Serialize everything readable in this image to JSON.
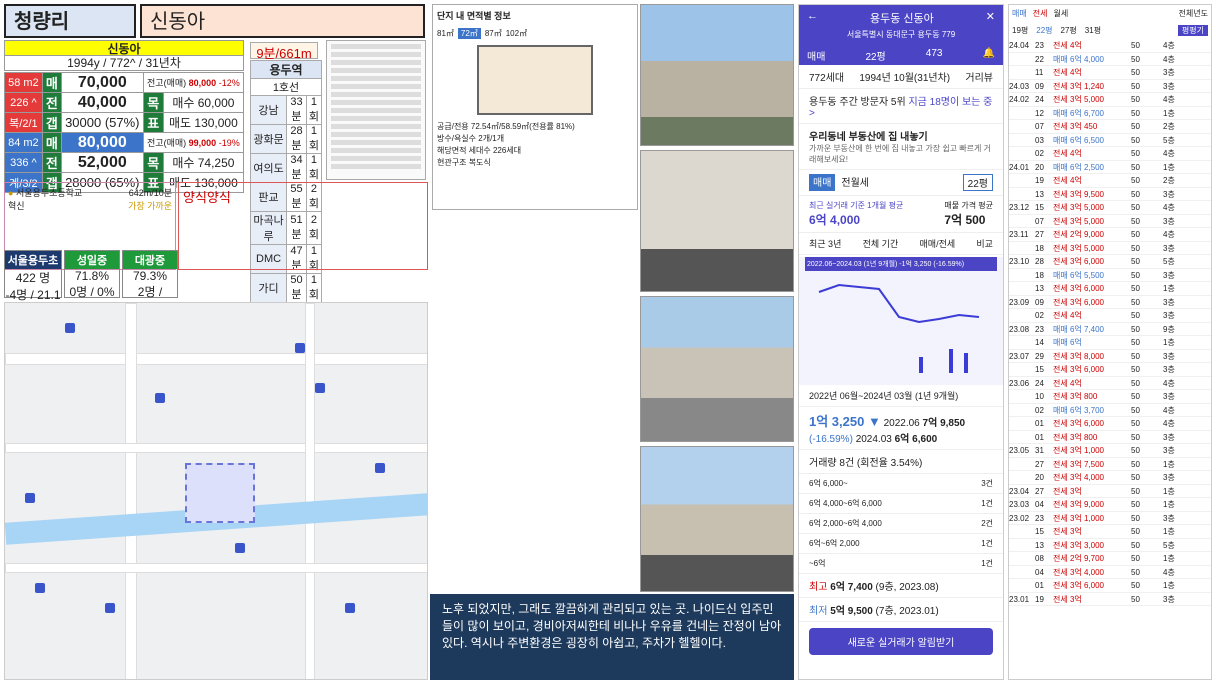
{
  "header": {
    "region": "청량리",
    "complex": "신동아"
  },
  "summary": {
    "name": "신동아",
    "sub": "1994y / 772^ / 31년차",
    "walk": "9분/661m"
  },
  "units": [
    {
      "size": "58 m2",
      "floors": "226 ^",
      "cfg": "복/2/1",
      "sale_label": "매",
      "sale": "70,000",
      "jeonse_label": "전",
      "jeonse": "40,000",
      "gap_label": "갭",
      "gap": "30000 (57%)",
      "high_label": "전고(매매)",
      "high": "80,000",
      "high_pct": "-12%",
      "mok": "목",
      "mok_label": "매수",
      "mok_val": "60,000",
      "pyo": "표",
      "pyo_label": "매도",
      "pyo_val": "130,000"
    },
    {
      "size": "84 m2",
      "floors": "336 ^",
      "cfg": "계/3/2",
      "sale_label": "매",
      "sale": "80,000",
      "jeonse_label": "전",
      "jeonse": "52,000",
      "gap_label": "갭",
      "gap": "28000 (65%)",
      "high_label": "전고(매매)",
      "high": "99,000",
      "high_pct": "-19%",
      "mok": "목",
      "mok_label": "매수",
      "mok_val": "74,250",
      "pyo": "표",
      "pyo_label": "매도",
      "pyo_val": "136,000"
    }
  ],
  "station": {
    "name": "용두역",
    "line": "1호선",
    "rows": [
      [
        "강남",
        "33분",
        "1회"
      ],
      [
        "광화문",
        "28분",
        "1회"
      ],
      [
        "여의도",
        "34분",
        "1회"
      ],
      [
        "판교",
        "55분",
        "2회"
      ],
      [
        "마곡나루",
        "51분",
        "2회"
      ],
      [
        "DMC",
        "47분",
        "1회"
      ],
      [
        "가디",
        "50분",
        "1회"
      ]
    ]
  },
  "school": {
    "name": "서울용두초등학교",
    "dist": "642m/10분",
    "type": "혁신",
    "note": "가장 가까운"
  },
  "memo": "양식양식",
  "schools": [
    {
      "name": "서울용두초",
      "v1": "422 명",
      "v2": "-4명 / 21.1"
    },
    {
      "name": "성일중",
      "v1": "71.8%",
      "v2": "0명 / 0%"
    },
    {
      "name": "대광중",
      "v1": "79.3%",
      "v2": "2명 / 1.6%"
    }
  ],
  "floorplan": {
    "title": "단지 내 면적별 정보",
    "tabs": [
      "81㎡",
      "72㎡",
      "87㎡",
      "102㎡"
    ],
    "label_area": "공급/전용",
    "area": "72.54㎡/58.59㎡(전용률 81%)",
    "label_rooms": "방수/욕실수",
    "rooms": "2개/1개",
    "label_count": "해당면적 세대수",
    "count": "226세대",
    "label_struct": "현관구조",
    "struct": "복도식"
  },
  "note": "노후 되었지만, 그래도 깔끔하게 관리되고 있는 곳. 나이드신 입주민들이 많이 보이고, 경비아저씨한테 비나나 우유를 건네는 잔정이 남아있다. 역시나 주변환경은 굉장히 아쉽고, 주차가 헬헬이다.",
  "app": {
    "title": "용두동 신동아",
    "address": "서울특별시 동대문구 용두동 779",
    "tab": "매매",
    "size": "22평",
    "comments": "473",
    "households": "772세대",
    "built": "1994년 10월(31년차)",
    "dist_btn": "거리뷰",
    "visitors": "용두동 주간 방문자 5위",
    "visitors_link": "지금 18명이 보는 중 >",
    "ad_title": "우리동네 부동산에 집 내놓기",
    "ad_body": "가까운 부동산에 한 번에 집 내놓고 가장 쉽고 빠르게 거래해보세요!",
    "tab_sale": "매매",
    "tab_jeonse": "전월세",
    "dd": "22평",
    "avg_label": "최근 실거래 기준 1개월 평균",
    "avg": "6억 4,000",
    "ask_label": "매물 가격 평균",
    "ask": "7억 500",
    "period_tabs": [
      "최근 3년",
      "전체 기간",
      "매매/전세",
      "비교"
    ],
    "chart_badge": "2022.06~2024.03 (1년 9개월)  -1억 3,250 (-16.59%)",
    "range": "2022년 06월~2024년 03월 (1년 9개월)",
    "drop": "1억 3,250 ▼",
    "drop_pct": "(-16.59%)",
    "p1_label": "2022.06",
    "p1": "7억 9,850",
    "p2_label": "2024.03",
    "p2": "6억 6,600",
    "vol": "거래량 8건 (회전율 3.54%)",
    "bins": [
      [
        "6억 6,000~",
        "3건"
      ],
      [
        "6억 4,000~6억 6,000",
        "1건"
      ],
      [
        "6억 2,000~6억 4,000",
        "2건"
      ],
      [
        "6억~6억 2,000",
        "1건"
      ],
      [
        "~6억",
        "1건"
      ]
    ],
    "hi_label": "최고",
    "hi": "6억 7,400",
    "hi_d": "(9층, 2023.08)",
    "lo_label": "최저",
    "lo": "5억 9,500",
    "lo_d": "(7층, 2023.01)",
    "alert": "새로운 실거래가 알림받기"
  },
  "tx": {
    "tabs": [
      "매매",
      "전세",
      "월세"
    ],
    "year": "전체년도",
    "size_tabs": [
      "19평",
      "22평",
      "27평",
      "31평"
    ],
    "btn": "평평기",
    "rows": [
      [
        "24.04",
        "23",
        "전세 4억",
        "50",
        "4층"
      ],
      [
        "",
        "22",
        "매매 6억 4,000",
        "50",
        "4층"
      ],
      [
        "",
        "11",
        "전세 4억",
        "50",
        "3층"
      ],
      [
        "24.03",
        "09",
        "전세 3억 1,240",
        "50",
        "3층"
      ],
      [
        "24.02",
        "24",
        "전세 3억 5,000",
        "50",
        "4층"
      ],
      [
        "",
        "12",
        "매매 6억 6,700",
        "50",
        "1층"
      ],
      [
        "",
        "07",
        "전세 3억 450",
        "50",
        "2층"
      ],
      [
        "",
        "03",
        "매매 6억 6,500",
        "50",
        "5층"
      ],
      [
        "",
        "02",
        "전세 4억",
        "50",
        "4층"
      ],
      [
        "24.01",
        "20",
        "매매 6억 2,500",
        "50",
        "1층"
      ],
      [
        "",
        "19",
        "전세 4억",
        "50",
        "2층"
      ],
      [
        "",
        "13",
        "전세 3억 9,500",
        "50",
        "3층"
      ],
      [
        "23.12",
        "15",
        "전세 3억 5,000",
        "50",
        "4층"
      ],
      [
        "",
        "07",
        "전세 3억 5,000",
        "50",
        "3층"
      ],
      [
        "23.11",
        "27",
        "전세 2억 9,000",
        "50",
        "4층"
      ],
      [
        "",
        "18",
        "전세 3억 5,000",
        "50",
        "3층"
      ],
      [
        "23.10",
        "28",
        "전세 3억 6,000",
        "50",
        "5층"
      ],
      [
        "",
        "18",
        "매매 6억 5,500",
        "50",
        "3층"
      ],
      [
        "",
        "13",
        "전세 3억 6,000",
        "50",
        "1층"
      ],
      [
        "23.09",
        "09",
        "전세 3억 6,000",
        "50",
        "3층"
      ],
      [
        "",
        "02",
        "전세 4억",
        "50",
        "3층"
      ],
      [
        "23.08",
        "23",
        "매매 6억 7,400",
        "50",
        "9층"
      ],
      [
        "",
        "14",
        "매매 6억",
        "50",
        "1층"
      ],
      [
        "23.07",
        "29",
        "전세 3억 8,000",
        "50",
        "3층"
      ],
      [
        "",
        "15",
        "전세 3억 6,000",
        "50",
        "3층"
      ],
      [
        "23.06",
        "24",
        "전세 4억",
        "50",
        "4층"
      ],
      [
        "",
        "10",
        "전세 3억 800",
        "50",
        "3층"
      ],
      [
        "",
        "02",
        "매매 6억 3,700",
        "50",
        "4층"
      ],
      [
        "",
        "01",
        "전세 3억 6,000",
        "50",
        "4층"
      ],
      [
        "",
        "01",
        "전세 3억 800",
        "50",
        "3층"
      ],
      [
        "23.05",
        "31",
        "전세 3억 1,000",
        "50",
        "3층"
      ],
      [
        "",
        "27",
        "전세 3억 7,500",
        "50",
        "1층"
      ],
      [
        "",
        "20",
        "전세 3억 4,000",
        "50",
        "3층"
      ],
      [
        "23.04",
        "27",
        "전세 3억",
        "50",
        "1층"
      ],
      [
        "23.03",
        "04",
        "전세 3억 9,000",
        "50",
        "1층"
      ],
      [
        "23.02",
        "23",
        "전세 3억 1,000",
        "50",
        "3층"
      ],
      [
        "",
        "15",
        "전세 3억",
        "50",
        "1층"
      ],
      [
        "",
        "13",
        "전세 3억 3,000",
        "50",
        "5층"
      ],
      [
        "",
        "08",
        "전세 2억 9,700",
        "50",
        "1층"
      ],
      [
        "",
        "04",
        "전세 3억 4,000",
        "50",
        "4층"
      ],
      [
        "",
        "01",
        "전세 3억 6,000",
        "50",
        "1층"
      ],
      [
        "23.01",
        "19",
        "전세 3억",
        "50",
        "3층"
      ]
    ]
  }
}
